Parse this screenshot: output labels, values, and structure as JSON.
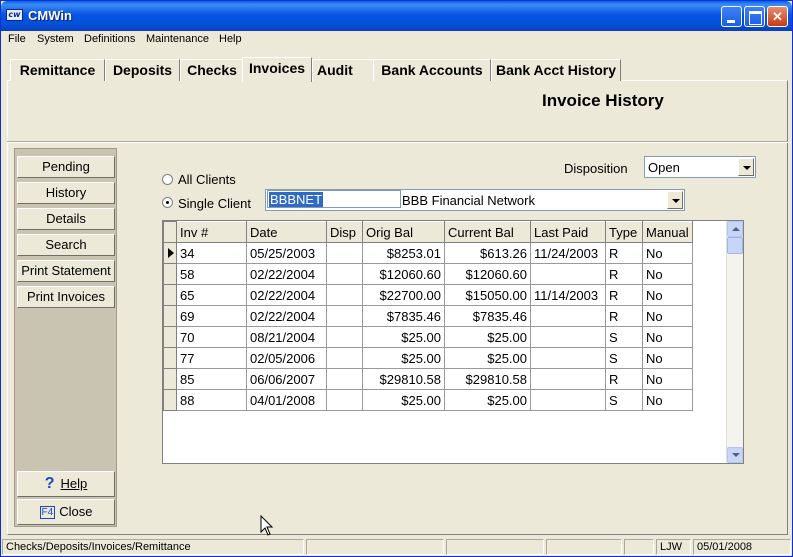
{
  "window": {
    "title": "CMWin",
    "app_icon": "cmw-logo-icon"
  },
  "menu": [
    "File",
    "System",
    "Definitions",
    "Maintenance",
    "Help"
  ],
  "tabs": [
    "Remittance",
    "Deposits",
    "Checks",
    "Invoices",
    "Audit",
    "Bank Accounts",
    "Bank Acct History"
  ],
  "active_tab": "Invoices",
  "page_title": "Invoice History",
  "sidebar": {
    "items": [
      "Pending",
      "History",
      "Details",
      "Search",
      "Print Statement",
      "Print Invoices"
    ],
    "help_label": "Help",
    "close_key": "F4",
    "close_label": "Close"
  },
  "filters": {
    "all_clients_label": "All Clients",
    "single_client_label": "Single Client",
    "selected_option": "Single Client",
    "client_code": "BBBNET",
    "client_name": "BBB Financial Network",
    "disposition_label": "Disposition",
    "disposition_value": "Open"
  },
  "grid": {
    "columns": [
      "Inv #",
      "Date",
      "Disp",
      "Orig Bal",
      "Current Bal",
      "Last Paid",
      "Type",
      "Manual"
    ],
    "rows": [
      [
        "34",
        "05/25/2003",
        "",
        "$8253.01",
        "$613.26",
        "11/24/2003",
        "R",
        "No"
      ],
      [
        "58",
        "02/22/2004",
        "",
        "$12060.60",
        "$12060.60",
        "",
        "R",
        "No"
      ],
      [
        "65",
        "02/22/2004",
        "",
        "$22700.00",
        "$15050.00",
        "11/14/2003",
        "R",
        "No"
      ],
      [
        "69",
        "02/22/2004",
        "",
        "$7835.46",
        "$7835.46",
        "",
        "R",
        "No"
      ],
      [
        "70",
        "08/21/2004",
        "",
        "$25.00",
        "$25.00",
        "",
        "S",
        "No"
      ],
      [
        "77",
        "02/05/2006",
        "",
        "$25.00",
        "$25.00",
        "",
        "S",
        "No"
      ],
      [
        "85",
        "06/06/2007",
        "",
        "$29810.58",
        "$29810.58",
        "",
        "R",
        "No"
      ],
      [
        "88",
        "04/01/2008",
        "",
        "$25.00",
        "$25.00",
        "",
        "S",
        "No"
      ]
    ],
    "current_row": 0
  },
  "statusbar": {
    "path": "Checks/Deposits/Invoices/Remittance",
    "user": "LJW",
    "date": "05/01/2008"
  }
}
